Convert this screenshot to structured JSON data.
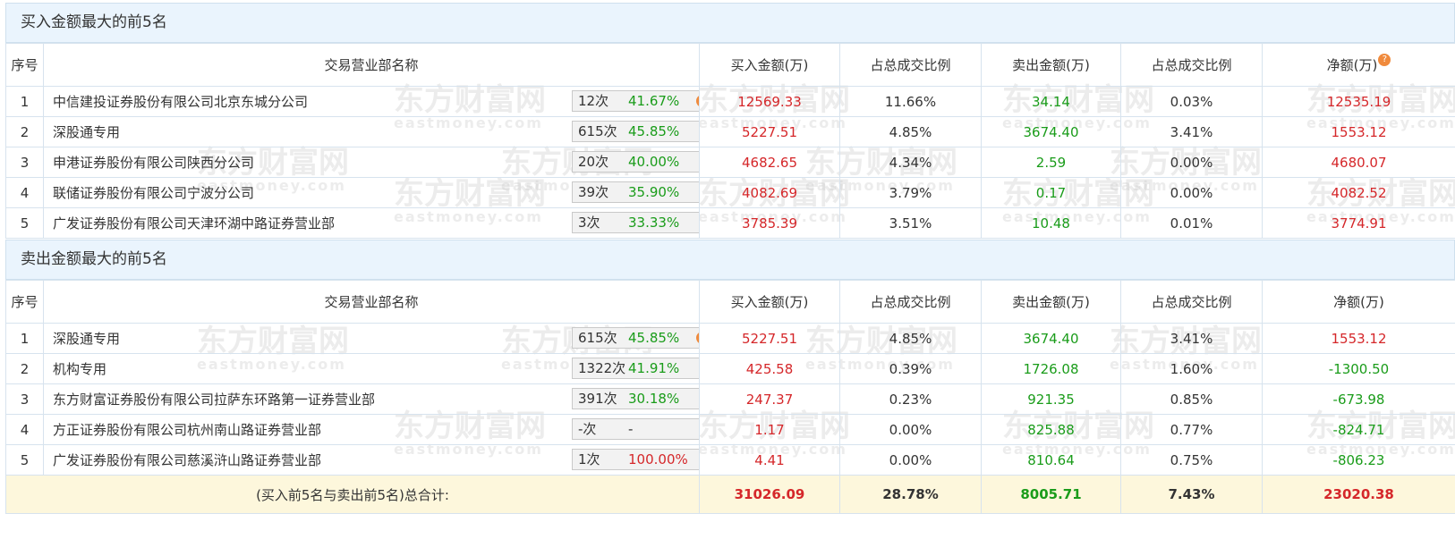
{
  "watermark": {
    "cn": "东方财富网",
    "en": "eastmoney.com"
  },
  "buy_section": {
    "title": "买入金额最大的前5名",
    "headers": {
      "idx": "序号",
      "name": "交易营业部名称",
      "buy": "买入金额(万)",
      "buy_pct": "占总成交比例",
      "sell": "卖出金额(万)",
      "sell_pct": "占总成交比例",
      "net": "净额(万)"
    },
    "rows": [
      {
        "idx": "1",
        "name": "中信建投证券股份有限公司北京东城分公司",
        "count": "12次",
        "rate": "41.67%",
        "rate_color": "green",
        "buy": "12569.33",
        "buy_pct": "11.66%",
        "sell": "34.14",
        "sell_pct": "0.03%",
        "net": "12535.19",
        "net_color": "red",
        "icon": "help-icon"
      },
      {
        "idx": "2",
        "name": "深股通专用",
        "count": "615次",
        "rate": "45.85%",
        "rate_color": "green",
        "buy": "5227.51",
        "buy_pct": "4.85%",
        "sell": "3674.40",
        "sell_pct": "3.41%",
        "net": "1553.12",
        "net_color": "red",
        "icon": "expand-arrow-icon"
      },
      {
        "idx": "3",
        "name": "申港证券股份有限公司陕西分公司",
        "count": "20次",
        "rate": "40.00%",
        "rate_color": "green",
        "buy": "4682.65",
        "buy_pct": "4.34%",
        "sell": "2.59",
        "sell_pct": "0.00%",
        "net": "4680.07",
        "net_color": "red",
        "icon": "expand-arrow-icon"
      },
      {
        "idx": "4",
        "name": "联储证券股份有限公司宁波分公司",
        "count": "39次",
        "rate": "35.90%",
        "rate_color": "green",
        "buy": "4082.69",
        "buy_pct": "3.79%",
        "sell": "0.17",
        "sell_pct": "0.00%",
        "net": "4082.52",
        "net_color": "red",
        "icon": "expand-arrow-icon"
      },
      {
        "idx": "5",
        "name": "广发证券股份有限公司天津环湖中路证券营业部",
        "count": "3次",
        "rate": "33.33%",
        "rate_color": "green",
        "buy": "3785.39",
        "buy_pct": "3.51%",
        "sell": "10.48",
        "sell_pct": "0.01%",
        "net": "3774.91",
        "net_color": "red",
        "icon": "expand-arrow-icon"
      }
    ]
  },
  "sell_section": {
    "title": "卖出金额最大的前5名",
    "headers": {
      "idx": "序号",
      "name": "交易营业部名称",
      "buy": "买入金额(万)",
      "buy_pct": "占总成交比例",
      "sell": "卖出金额(万)",
      "sell_pct": "占总成交比例",
      "net": "净额(万)"
    },
    "rows": [
      {
        "idx": "1",
        "name": "深股通专用",
        "count": "615次",
        "rate": "45.85%",
        "rate_color": "green",
        "buy": "5227.51",
        "buy_pct": "4.85%",
        "sell": "3674.40",
        "sell_pct": "3.41%",
        "net": "1553.12",
        "net_color": "red",
        "icon": "help-icon"
      },
      {
        "idx": "2",
        "name": "机构专用",
        "count": "1322次",
        "rate": "41.91%",
        "rate_color": "green",
        "buy": "425.58",
        "buy_pct": "0.39%",
        "sell": "1726.08",
        "sell_pct": "1.60%",
        "net": "-1300.50",
        "net_color": "green",
        "icon": "expand-arrow-icon"
      },
      {
        "idx": "3",
        "name": "东方财富证券股份有限公司拉萨东环路第一证券营业部",
        "count": "391次",
        "rate": "30.18%",
        "rate_color": "green",
        "buy": "247.37",
        "buy_pct": "0.23%",
        "sell": "921.35",
        "sell_pct": "0.85%",
        "net": "-673.98",
        "net_color": "green",
        "icon": "expand-arrow-icon"
      },
      {
        "idx": "4",
        "name": "方正证券股份有限公司杭州南山路证券营业部",
        "count": "-次",
        "rate": "-",
        "rate_color": "black",
        "buy": "1.17",
        "buy_pct": "0.00%",
        "sell": "825.88",
        "sell_pct": "0.77%",
        "net": "-824.71",
        "net_color": "green",
        "icon": "expand-arrow-icon"
      },
      {
        "idx": "5",
        "name": "广发证券股份有限公司慈溪浒山路证券营业部",
        "count": "1次",
        "rate": "100.00%",
        "rate_color": "red",
        "buy": "4.41",
        "buy_pct": "0.00%",
        "sell": "810.64",
        "sell_pct": "0.75%",
        "net": "-806.23",
        "net_color": "green",
        "icon": "expand-arrow-icon"
      }
    ]
  },
  "total": {
    "label": "(买入前5名与卖出前5名)总合计:",
    "buy": "31026.09",
    "buy_pct": "28.78%",
    "sell": "8005.71",
    "sell_pct": "7.43%",
    "net": "23020.38"
  },
  "colors": {
    "red": "#d5272a",
    "green": "#1a9c1a",
    "header_bg": "#eaf4fd",
    "total_bg": "#fdf7dc",
    "border": "#d7e3ee"
  }
}
